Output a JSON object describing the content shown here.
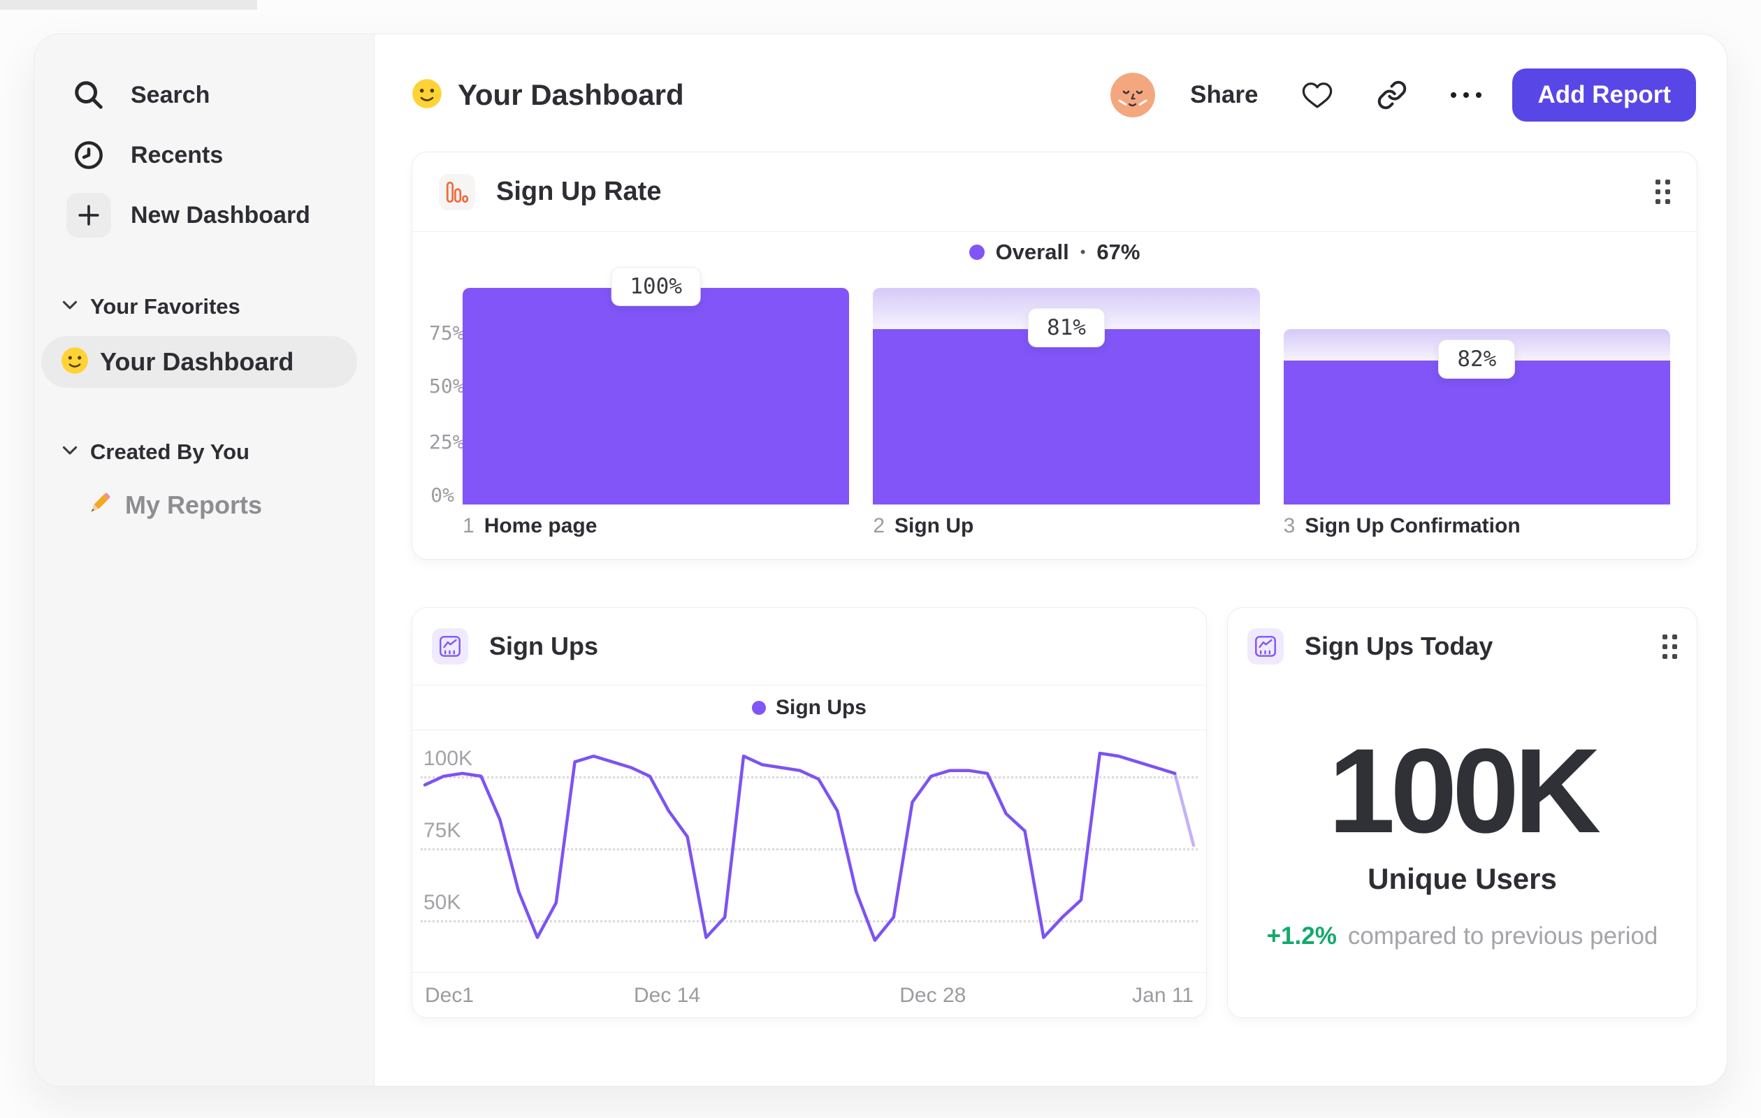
{
  "sidebar": {
    "nav": [
      {
        "label": "Search"
      },
      {
        "label": "Recents"
      },
      {
        "label": "New Dashboard"
      }
    ],
    "favorites_title": "Your Favorites",
    "favorites_item": "Your Dashboard",
    "created_title": "Created By You",
    "created_item": "My Reports"
  },
  "header": {
    "title": "Your Dashboard",
    "share": "Share",
    "add_report": "Add Report"
  },
  "funnel_card": {
    "title": "Sign Up Rate",
    "legend_name": "Overall",
    "legend_sep": "•",
    "legend_value": "67%"
  },
  "line_card": {
    "title": "Sign Ups",
    "legend": "Sign Ups"
  },
  "today_card": {
    "title": "Sign Ups Today",
    "value": "100K",
    "label": "Unique Users",
    "delta": "+1.2%",
    "context": "compared to previous period"
  },
  "colors": {
    "chart_purple": "#8155f7",
    "line_purple": "#7c53f3",
    "button_purple": "#5847e6",
    "icon_orange": "#f26a3d",
    "delta_green": "#12a96c"
  },
  "chart_data": [
    {
      "type": "bar",
      "subtype": "funnel",
      "title": "Sign Up Rate",
      "legend": "Overall",
      "overall_conversion": "67%",
      "step_numbers": [
        "1",
        "2",
        "3"
      ],
      "categories": [
        "Home page",
        "Sign Up",
        "Sign Up Confirmation"
      ],
      "values": [
        100,
        81,
        82
      ],
      "value_labels": [
        "100%",
        "81%",
        "82%"
      ],
      "overall_pct": [
        100,
        81,
        66.4
      ],
      "y_ticks": [
        "75%",
        "50%",
        "25%",
        "0%"
      ],
      "ylim": [
        0,
        100
      ],
      "grid": false,
      "legend_position": "top-center",
      "bar_color": "#8155f7"
    },
    {
      "type": "line",
      "title": "Sign Ups",
      "legend": "Sign Ups",
      "x_ticks": [
        "Dec1",
        "Dec 14",
        "Dec 28",
        "Jan 11"
      ],
      "x_tick_indices": [
        0,
        13,
        27,
        41
      ],
      "y_ticks": [
        "100K",
        "75K",
        "50K"
      ],
      "y_tick_values_thousands": [
        100,
        75,
        50
      ],
      "values_thousands": [
        97,
        100,
        101,
        100,
        85,
        60,
        44,
        56,
        105,
        107,
        105,
        103,
        100,
        88,
        79,
        44,
        51,
        107,
        104,
        103,
        102,
        99,
        88,
        60,
        43,
        51,
        91,
        100,
        102,
        102,
        101,
        87,
        81,
        44,
        51,
        57,
        108,
        107,
        105,
        103,
        101,
        76
      ],
      "ylim_thousands": [
        32,
        116
      ],
      "grid": "dotted-horizontal",
      "legend_position": "top-center",
      "line_color": "#7c53f3",
      "faded_tail_points": 1
    },
    {
      "type": "metric",
      "title": "Sign Ups Today",
      "value": "100K",
      "label": "Unique Users",
      "delta": "+1.2%",
      "context": "compared to previous period"
    }
  ]
}
